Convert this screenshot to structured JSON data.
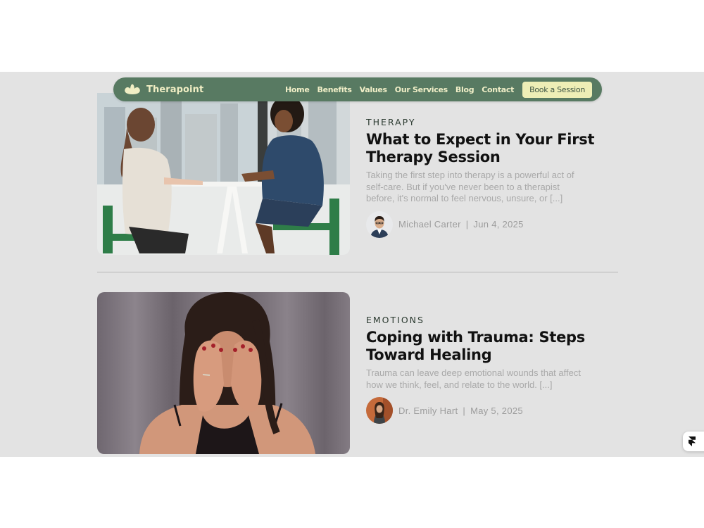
{
  "brand": {
    "name": "Therapoint",
    "color": "#587a62",
    "accent": "#eeeeb6"
  },
  "nav": {
    "links": [
      "Home",
      "Benefits",
      "Values",
      "Our Services",
      "Blog",
      "Contact"
    ],
    "cta": "Book a Session"
  },
  "articles": [
    {
      "category": "THERAPY",
      "title": "What to Expect in Your First Therapy Session",
      "excerpt": "Taking the first step into therapy is a powerful act of self-care. But if you've never been to a therapist before, it's normal to feel nervous, unsure, or [...]",
      "author": "Michael Carter",
      "date": "Jun 4, 2025"
    },
    {
      "category": "EMOTIONS",
      "title": "Coping with Trauma: Steps Toward Healing",
      "excerpt": "Trauma can leave deep emotional wounds that affect how we think, feel, and relate to the world. [...]",
      "author": "Dr. Emily Hart",
      "date": "May 5, 2025"
    }
  ],
  "byline_separator": "|",
  "badge": {
    "icon": "framer-logo-icon"
  }
}
